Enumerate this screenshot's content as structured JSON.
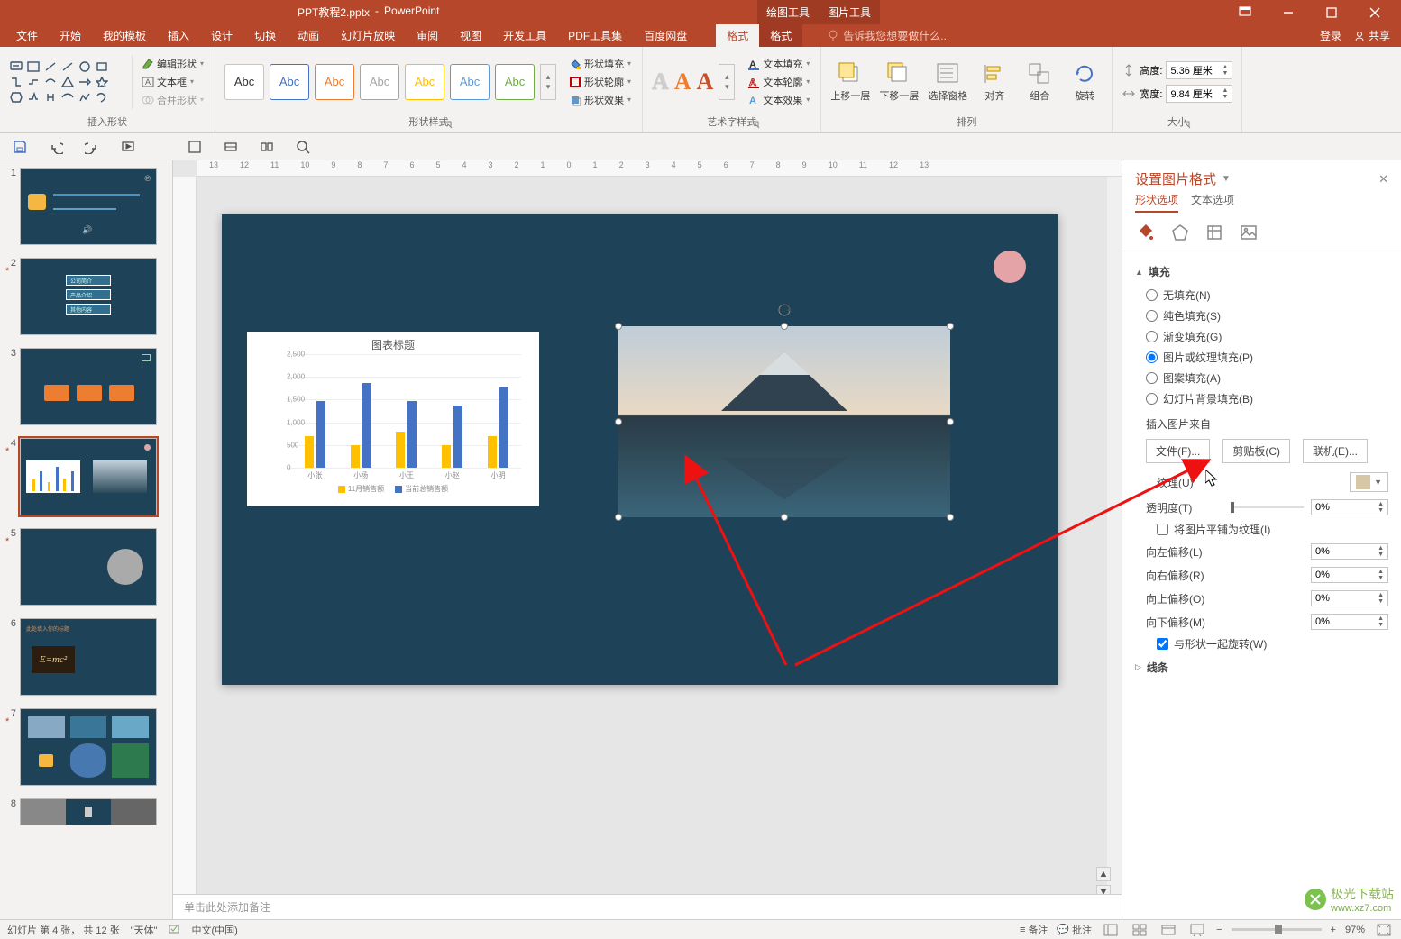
{
  "title": {
    "doc": "PPT教程2.pptx",
    "app": "PowerPoint"
  },
  "context_tabs": [
    "绘图工具",
    "图片工具"
  ],
  "window_ribbon": {
    "login": "登录",
    "share": "共享"
  },
  "tabs": [
    "文件",
    "开始",
    "我的模板",
    "插入",
    "设计",
    "切换",
    "动画",
    "幻灯片放映",
    "审阅",
    "视图",
    "开发工具",
    "PDF工具集",
    "百度网盘"
  ],
  "format_tab": "格式",
  "tellme_placeholder": "告诉我您想要做什么...",
  "ribbon_groups": {
    "insert_shapes": {
      "label": "插入形状",
      "edit": "编辑形状",
      "textbox": "文本框",
      "merge": "合并形状"
    },
    "shape_styles": {
      "label": "形状样式",
      "abc": "Abc",
      "fill": "形状填充",
      "outline": "形状轮廓",
      "effects": "形状效果"
    },
    "wordart": {
      "label": "艺术字样式",
      "fill": "文本填充",
      "outline": "文本轮廓",
      "effects": "文本效果"
    },
    "arrange": {
      "label": "排列",
      "forward": "上移一层",
      "backward": "下移一层",
      "pane": "选择窗格",
      "align": "对齐",
      "group": "组合",
      "rotate": "旋转"
    },
    "size": {
      "label": "大小",
      "height": "高度:",
      "height_val": "5.36 厘米",
      "width": "宽度:",
      "width_val": "9.84 厘米"
    }
  },
  "thumbs": {
    "count": 8
  },
  "ruler_h": [
    "13",
    "12",
    "11",
    "10",
    "9",
    "8",
    "7",
    "6",
    "5",
    "4",
    "3",
    "2",
    "1",
    "0",
    "1",
    "2",
    "3",
    "4",
    "5",
    "6",
    "7",
    "8",
    "9",
    "10",
    "11",
    "12",
    "13"
  ],
  "chart_data": {
    "type": "bar",
    "title": "图表标题",
    "categories": [
      "小张",
      "小杨",
      "小王",
      "小赵",
      "小明"
    ],
    "y_ticks": [
      0,
      500,
      1000,
      1500,
      2000,
      2500
    ],
    "series": [
      {
        "name": "11月销售额",
        "color": "#ffc000",
        "values": [
          700,
          500,
          800,
          500,
          700
        ]
      },
      {
        "name": "当前总销售额",
        "color": "#4472c4",
        "values": [
          1500,
          1900,
          1500,
          1400,
          1800
        ]
      }
    ],
    "ylim": [
      0,
      2500
    ]
  },
  "notes_placeholder": "单击此处添加备注",
  "pane": {
    "title": "设置图片格式",
    "tabs": [
      "形状选项",
      "文本选项"
    ],
    "section_fill": "填充",
    "fill_opts": [
      "无填充(N)",
      "纯色填充(S)",
      "渐变填充(G)",
      "图片或纹理填充(P)",
      "图案填充(A)",
      "幻灯片背景填充(B)"
    ],
    "insert_from": "插入图片来自",
    "buttons": [
      "文件(F)...",
      "剪贴板(C)",
      "联机(E)..."
    ],
    "texture": "纹理(U)",
    "transparency": "透明度(T)",
    "tile": "将图片平铺为纹理(I)",
    "offset_l": {
      "label": "向左偏移(L)",
      "val": "0%"
    },
    "offset_r": {
      "label": "向右偏移(R)",
      "val": "0%"
    },
    "offset_t": {
      "label": "向上偏移(O)",
      "val": "0%"
    },
    "offset_b": {
      "label": "向下偏移(M)",
      "val": "0%"
    },
    "rotate_with": "与形状一起旋转(W)",
    "section_line": "线条",
    "pct0": "0%"
  },
  "status": {
    "slide_info": "幻灯片 第 4 张， 共 12 张",
    "theme": "\"天体\"",
    "lang_cn": "中文(中国)",
    "notes": "备注",
    "comments": "批注",
    "zoom": "97%"
  },
  "watermark": {
    "brand": "极光下载站",
    "url": "www.xz7.com"
  }
}
